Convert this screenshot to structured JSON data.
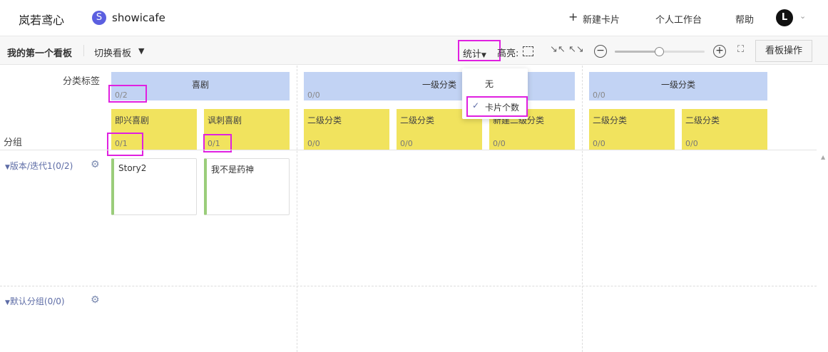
{
  "topnav": {
    "brand": "岚若鸢心",
    "project_avatar_letter": "S",
    "project_name": "showicafe",
    "new_card_icon": "+",
    "new_card": "新建卡片",
    "workspace": "个人工作台",
    "help": "帮助",
    "user_avatar_letter": "L"
  },
  "toolbar": {
    "board_name": "我的第一个看板",
    "switch_board": "切换看板",
    "stats": "统计",
    "highlight": "高亮:",
    "zoom_minus": "−",
    "zoom_plus": "+",
    "zoom_level": 0.5,
    "board_ops": "看板操作"
  },
  "stats_menu": {
    "items": [
      "无",
      "卡片个数"
    ],
    "selected": "卡片个数"
  },
  "board": {
    "category_label": "分类标签",
    "group_label": "分组",
    "categories": [
      {
        "title": "喜剧",
        "count": "0/2"
      },
      {
        "title": "一级分类",
        "count": "0/0"
      },
      {
        "title": "一级分类",
        "count": "0/0"
      }
    ],
    "subcategories": [
      {
        "title": "即兴喜剧",
        "count": "0/1"
      },
      {
        "title": "讽刺喜剧",
        "count": "0/1"
      },
      {
        "title": "二级分类",
        "count": "0/0"
      },
      {
        "title": "二级分类",
        "count": "0/0"
      },
      {
        "title": "新建二级分类",
        "count": "0/0"
      },
      {
        "title": "二级分类",
        "count": "0/0"
      },
      {
        "title": "二级分类",
        "count": "0/0"
      }
    ],
    "groups": [
      {
        "title": "版本/迭代1(0/2)"
      },
      {
        "title": "默认分组(0/0)"
      }
    ],
    "cards": [
      "Story2",
      "我不是药神"
    ]
  },
  "colors": {
    "category_bg": "#c2d3f4",
    "subcategory_bg": "#f1e35e",
    "highlight_mark": "#e020e0",
    "group_text": "#5d6ca6",
    "card_accent": "#9acd7a"
  }
}
